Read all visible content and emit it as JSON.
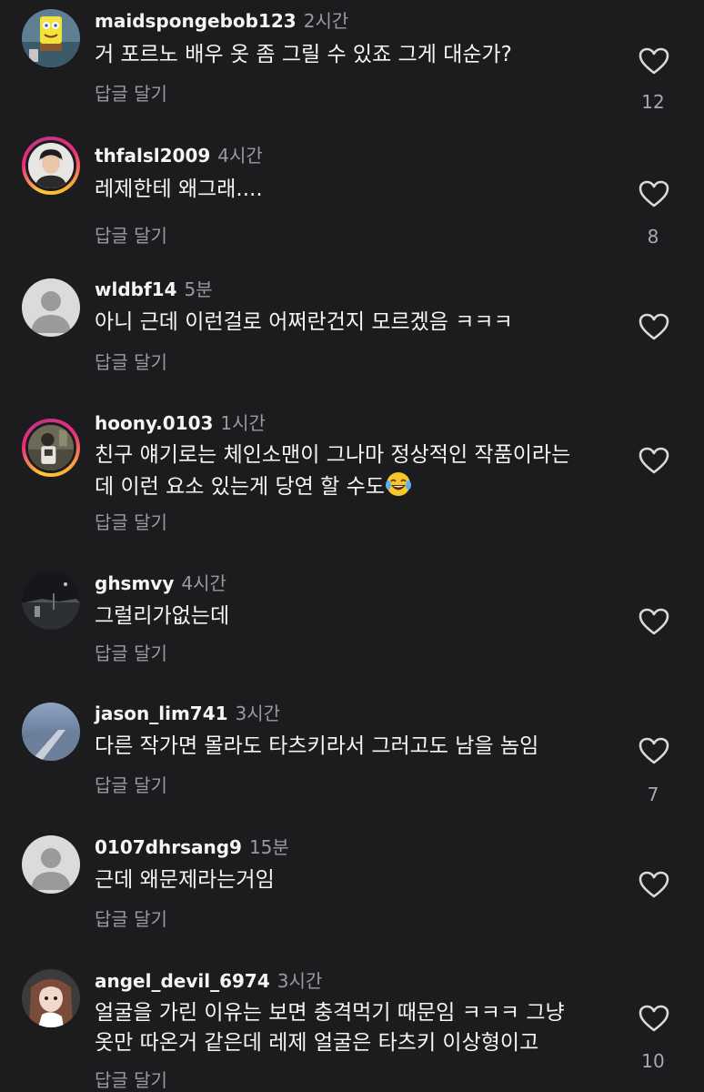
{
  "reply_label": "답글 달기",
  "comments": [
    {
      "username": "maidspongebob123",
      "time": "2시간",
      "text": "거 포르노 배우 옷 좀 그릴 수 있죠 그게 대순가?",
      "likes": "12"
    },
    {
      "username": "thfalsl2009",
      "time": "4시간",
      "text": "레제한테 왜그래....",
      "likes": "8"
    },
    {
      "username": "wldbf14",
      "time": "5분",
      "text": "아니 근데 이런걸로 어쩌란건지 모르겠음 ㅋㅋㅋ",
      "likes": ""
    },
    {
      "username": "hoony.0103",
      "time": "1시간",
      "text_line1": "친구 얘기로는 체인소맨이 그나마 정상적인 작품이라는",
      "text_line2": "데 이런 요소 있는게 당연 할 수도",
      "emoji": "face-with-tears-of-joy",
      "likes": ""
    },
    {
      "username": "ghsmvy",
      "time": "4시간",
      "text": "그럴리가없는데",
      "likes": ""
    },
    {
      "username": "jason_lim741",
      "time": "3시간",
      "text": "다른 작가면 몰라도 타츠키라서 그러고도 남을 놈임",
      "likes": "7"
    },
    {
      "username": "0107dhrsang9",
      "time": "15분",
      "text": "근데 왜문제라는거임",
      "likes": ""
    },
    {
      "username": "angel_devil_6974",
      "time": "3시간",
      "text_line1": "얼굴을 가린 이유는 보면 충격먹기 때문임 ㅋㅋㅋ 그냥",
      "text_line2": "옷만 따온거 같은데 레제 얼굴은 타츠키 이상형이고",
      "likes": "10"
    }
  ],
  "colors": {
    "background": "#1c1c1f",
    "text_primary": "#f5f5f5",
    "text_secondary": "#9a9a9e",
    "story_ring": "#ee2a7b"
  }
}
